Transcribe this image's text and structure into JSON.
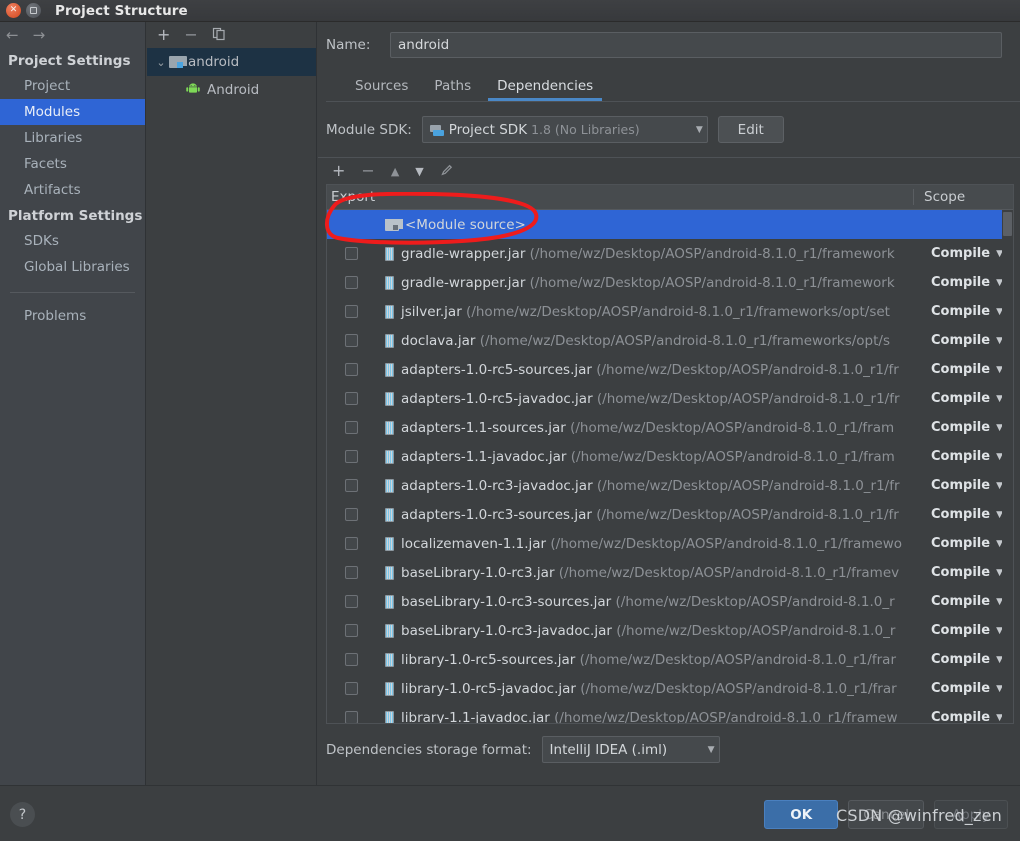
{
  "window": {
    "title": "Project Structure",
    "controls": {
      "close": "×",
      "maximize": "□"
    }
  },
  "sidebar": {
    "nav": {
      "back": "←",
      "forward": "→"
    },
    "groups": [
      {
        "label": "Project Settings",
        "items": [
          {
            "label": "Project",
            "selected": false
          },
          {
            "label": "Modules",
            "selected": true
          },
          {
            "label": "Libraries",
            "selected": false
          },
          {
            "label": "Facets",
            "selected": false
          },
          {
            "label": "Artifacts",
            "selected": false
          }
        ]
      },
      {
        "label": "Platform Settings",
        "items": [
          {
            "label": "SDKs",
            "selected": false
          },
          {
            "label": "Global Libraries",
            "selected": false
          }
        ]
      }
    ],
    "problems": "Problems"
  },
  "tree": {
    "toolbar": {
      "add": "+",
      "remove": "−",
      "copy": "copy-icon"
    },
    "nodes": [
      {
        "label": "android",
        "expander": "⌄",
        "icon": "module-icon",
        "selected": true
      },
      {
        "label": "Android",
        "icon": "android-icon",
        "selected": false
      }
    ]
  },
  "main": {
    "name_label": "Name:",
    "name_value": "android",
    "tabs": [
      {
        "label": "Sources",
        "active": false
      },
      {
        "label": "Paths",
        "active": false
      },
      {
        "label": "Dependencies",
        "active": true
      }
    ],
    "sdk": {
      "label": "Module SDK:",
      "value_main": "Project SDK",
      "value_sub": "1.8 (No Libraries)",
      "caret": "▼",
      "edit_button": "Edit"
    },
    "dep_toolbar": {
      "add": "+",
      "remove": "−",
      "up": "▲",
      "down": "▼",
      "edit": "✎"
    },
    "columns": {
      "export": "Export",
      "scope": "Scope"
    },
    "rows": [
      {
        "checkbox": false,
        "icon": "module-source-icon",
        "name": "<Module source>",
        "path": "",
        "scope": "",
        "selected": true
      },
      {
        "checkbox": false,
        "icon": "jar-icon",
        "name": "gradle-wrapper.jar",
        "path": "(/home/wz/Desktop/AOSP/android-8.1.0_r1/framework",
        "scope": "Compile",
        "selected": false
      },
      {
        "checkbox": false,
        "icon": "jar-icon",
        "name": "gradle-wrapper.jar",
        "path": "(/home/wz/Desktop/AOSP/android-8.1.0_r1/framework",
        "scope": "Compile",
        "selected": false
      },
      {
        "checkbox": false,
        "icon": "jar-icon",
        "name": "jsilver.jar",
        "path": "(/home/wz/Desktop/AOSP/android-8.1.0_r1/frameworks/opt/set",
        "scope": "Compile",
        "selected": false
      },
      {
        "checkbox": false,
        "icon": "jar-icon",
        "name": "doclava.jar",
        "path": "(/home/wz/Desktop/AOSP/android-8.1.0_r1/frameworks/opt/s",
        "scope": "Compile",
        "selected": false
      },
      {
        "checkbox": false,
        "icon": "jar-icon",
        "name": "adapters-1.0-rc5-sources.jar",
        "path": "(/home/wz/Desktop/AOSP/android-8.1.0_r1/fr",
        "scope": "Compile",
        "selected": false
      },
      {
        "checkbox": false,
        "icon": "jar-icon",
        "name": "adapters-1.0-rc5-javadoc.jar",
        "path": "(/home/wz/Desktop/AOSP/android-8.1.0_r1/fr",
        "scope": "Compile",
        "selected": false
      },
      {
        "checkbox": false,
        "icon": "jar-icon",
        "name": "adapters-1.1-sources.jar",
        "path": "(/home/wz/Desktop/AOSP/android-8.1.0_r1/fram",
        "scope": "Compile",
        "selected": false
      },
      {
        "checkbox": false,
        "icon": "jar-icon",
        "name": "adapters-1.1-javadoc.jar",
        "path": "(/home/wz/Desktop/AOSP/android-8.1.0_r1/fram",
        "scope": "Compile",
        "selected": false
      },
      {
        "checkbox": false,
        "icon": "jar-icon",
        "name": "adapters-1.0-rc3-javadoc.jar",
        "path": "(/home/wz/Desktop/AOSP/android-8.1.0_r1/fr",
        "scope": "Compile",
        "selected": false
      },
      {
        "checkbox": false,
        "icon": "jar-icon",
        "name": "adapters-1.0-rc3-sources.jar",
        "path": "(/home/wz/Desktop/AOSP/android-8.1.0_r1/fr",
        "scope": "Compile",
        "selected": false
      },
      {
        "checkbox": false,
        "icon": "jar-icon",
        "name": "localizemaven-1.1.jar",
        "path": "(/home/wz/Desktop/AOSP/android-8.1.0_r1/framewo",
        "scope": "Compile",
        "selected": false
      },
      {
        "checkbox": false,
        "icon": "jar-icon",
        "name": "baseLibrary-1.0-rc3.jar",
        "path": "(/home/wz/Desktop/AOSP/android-8.1.0_r1/framev",
        "scope": "Compile",
        "selected": false
      },
      {
        "checkbox": false,
        "icon": "jar-icon",
        "name": "baseLibrary-1.0-rc3-sources.jar",
        "path": "(/home/wz/Desktop/AOSP/android-8.1.0_r",
        "scope": "Compile",
        "selected": false
      },
      {
        "checkbox": false,
        "icon": "jar-icon",
        "name": "baseLibrary-1.0-rc3-javadoc.jar",
        "path": "(/home/wz/Desktop/AOSP/android-8.1.0_r",
        "scope": "Compile",
        "selected": false
      },
      {
        "checkbox": false,
        "icon": "jar-icon",
        "name": "library-1.0-rc5-sources.jar",
        "path": "(/home/wz/Desktop/AOSP/android-8.1.0_r1/frar",
        "scope": "Compile",
        "selected": false
      },
      {
        "checkbox": false,
        "icon": "jar-icon",
        "name": "library-1.0-rc5-javadoc.jar",
        "path": "(/home/wz/Desktop/AOSP/android-8.1.0_r1/frar",
        "scope": "Compile",
        "selected": false
      },
      {
        "checkbox": false,
        "icon": "jar-icon",
        "name": "library-1.1-javadoc.jar",
        "path": "(/home/wz/Desktop/AOSP/android-8.1.0_r1/framew",
        "scope": "Compile",
        "selected": false
      }
    ],
    "storage": {
      "label": "Dependencies storage format:",
      "value": "IntelliJ IDEA (.iml)",
      "caret": "▼"
    }
  },
  "footer": {
    "help": "?",
    "ok": "OK",
    "cancel": "Cancel",
    "apply": "Apply"
  },
  "watermark": "CSDN @winfred_zen",
  "colors": {
    "accent_blue": "#2f65d5",
    "tab_underline": "#4a88c7",
    "ok_button": "#3b6ea8",
    "annotation_red": "#ee1c1c",
    "android_green": "#7ed957",
    "window_close": "#d2481d"
  }
}
